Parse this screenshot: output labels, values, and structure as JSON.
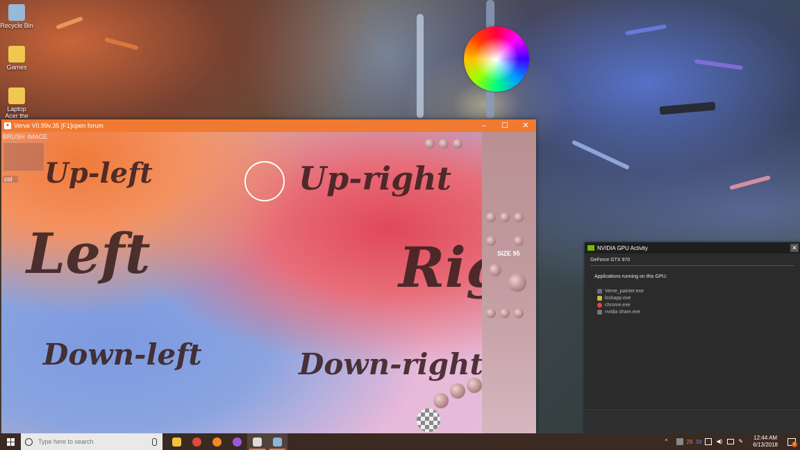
{
  "desktop": {
    "icons": [
      {
        "label": "Recycle Bin"
      },
      {
        "label": "Games"
      },
      {
        "label": "Laptop Acer the Black"
      }
    ]
  },
  "verve": {
    "title": "Verve V0.99v.35 [F1]open forum",
    "tabs": [
      "BRUSH",
      "IMAGE"
    ],
    "col_label": "col",
    "size_label": "SIZE 95",
    "canvas_words": [
      "Up-left",
      "Up-right",
      "Left",
      "Rig",
      "Down-left",
      "Down-right"
    ],
    "window_controls": {
      "minimize": "–",
      "maximize": "☐",
      "close": "✕"
    }
  },
  "nvidia": {
    "title": "NVIDIA GPU Activity",
    "gpu": "GeForce GTX 970",
    "heading": "Applications running on this GPU:",
    "apps": [
      {
        "name": "Verve_painter.exe",
        "icon": "verve-icon",
        "color": "#6a6a8a"
      },
      {
        "name": "lockapp.exe",
        "icon": "lock-icon",
        "color": "#d8b340"
      },
      {
        "name": "chrome.exe",
        "icon": "chrome-icon",
        "color": "#e04a3a"
      },
      {
        "name": "nvidia share.exe",
        "icon": "nvidia-share-icon",
        "color": "#777777"
      }
    ]
  },
  "taskbar": {
    "search_placeholder": "Type here to search",
    "time": "12:44 AM",
    "date": "6/13/2018",
    "tray_numbers": [
      "29",
      "39"
    ],
    "notification_count": "1",
    "apps": [
      {
        "name": "file-explorer-icon",
        "color": "#f3c23c",
        "active": false
      },
      {
        "name": "chrome-icon",
        "color": "#e04a3a",
        "active": false
      },
      {
        "name": "firefox-icon",
        "color": "#f08a24",
        "active": false
      },
      {
        "name": "browser-icon",
        "color": "#9a5ad8",
        "active": false
      },
      {
        "name": "verve-icon",
        "color": "#dcdcdc",
        "active": true
      },
      {
        "name": "window-app-icon",
        "color": "#8ab4d8",
        "active": true
      }
    ]
  },
  "colors": {
    "verve_titlebar": "#f07a32",
    "nvidia_green": "#76b900",
    "taskbar": "#3a2a22"
  }
}
